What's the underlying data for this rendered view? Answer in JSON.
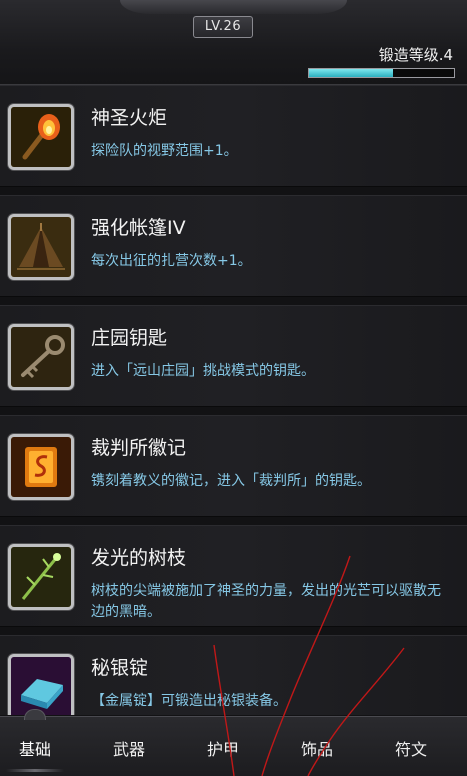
{
  "header": {
    "level": "LV.26",
    "forge_label": "锻造等级.4",
    "forge_progress": 0.58
  },
  "items": [
    {
      "name": "神圣火炬",
      "desc": "探险队的视野范围+1。",
      "icon": "torch-icon"
    },
    {
      "name": "强化帐篷IV",
      "desc": "每次出征的扎营次数+1。",
      "icon": "tent-icon"
    },
    {
      "name": "庄园钥匙",
      "desc": "进入「远山庄园」挑战模式的钥匙。",
      "icon": "key-icon"
    },
    {
      "name": "裁判所徽记",
      "desc": "镌刻着教义的徽记，进入「裁判所」的钥匙。",
      "icon": "emblem-icon"
    },
    {
      "name": "发光的树枝",
      "desc": "树枝的尖端被施加了神圣的力量，发出的光芒可以驱散无边的黑暗。",
      "icon": "branch-icon"
    },
    {
      "name": "秘银锭",
      "desc": "【金属锭】可锻造出秘银装备。",
      "icon": "ingot-icon"
    }
  ],
  "tabs": [
    "基础",
    "武器",
    "护甲",
    "饰品",
    "符文"
  ],
  "colors": {
    "desc_text": "#86c8e6",
    "progress_fill": "#2bb0c0",
    "slot_gold": "#d5a62a",
    "slot_purple": "#9c3fc0",
    "scribble": "#c01818"
  }
}
